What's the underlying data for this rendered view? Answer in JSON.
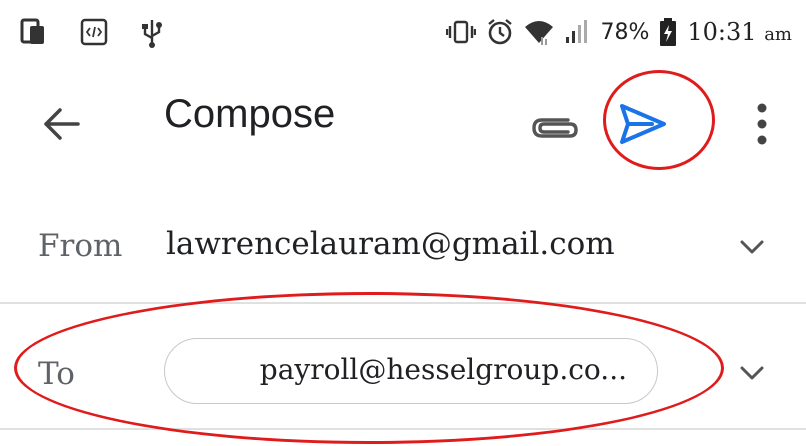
{
  "status_bar": {
    "left_icons": [
      "screen-mirror-icon",
      "developer-code-icon",
      "usb-icon"
    ],
    "right_icons": [
      "vibrate-icon",
      "alarm-clock-icon",
      "wifi-icon",
      "signal-icon",
      "battery-charging-icon"
    ],
    "battery_percent": "78%",
    "time": "10:31",
    "time_suffix": "am"
  },
  "app_bar": {
    "title": "Compose",
    "icons": [
      "back-arrow-icon",
      "paperclip-icon",
      "send-icon",
      "more-vert-icon"
    ]
  },
  "compose": {
    "from_label": "From",
    "from_value": "lawrencelauram@gmail.com",
    "to_label": "To",
    "to_chip": "payroll@hesselgroup.co..."
  },
  "colors": {
    "accent": "#1a73e8",
    "annotation": "#e01b1b",
    "text_primary": "#202124",
    "text_secondary": "#5f6368"
  }
}
